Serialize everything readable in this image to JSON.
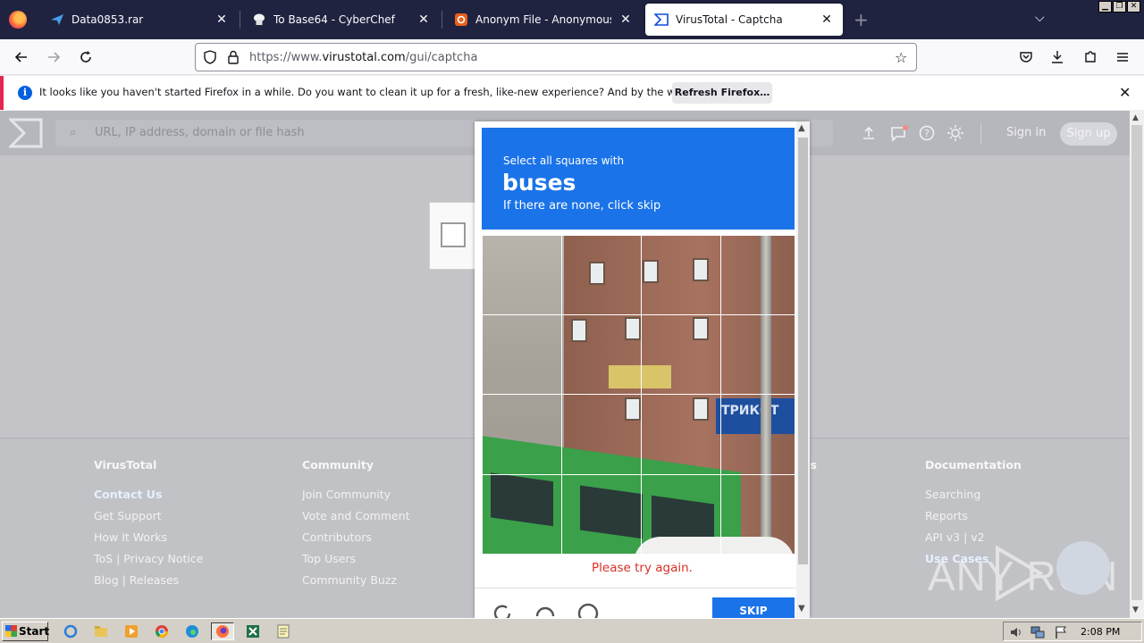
{
  "browser": {
    "tabs": [
      {
        "title": "Data0853.rar",
        "icon": "paperplane-icon"
      },
      {
        "title": "To Base64 - CyberChef",
        "icon": "chef-hat-icon"
      },
      {
        "title": "Anonym File - Anonymous File Uplo",
        "icon": "anonym-file-icon"
      },
      {
        "title": "VirusTotal - Captcha",
        "icon": "virustotal-icon",
        "active": true
      }
    ],
    "url_prefix": "https://www.",
    "url_domain": "virustotal.com",
    "url_path": "/gui/captcha"
  },
  "notification": {
    "message": "It looks like you haven't started Firefox in a while. Do you want to clean it up for a fresh, like-new experience? And by the way, welcome back!",
    "button": "Refresh Firefox…"
  },
  "vt": {
    "search_placeholder": "URL, IP address, domain or file hash",
    "signin": "Sign in",
    "signup": "Sign up"
  },
  "footer": {
    "columns": [
      {
        "heading": "VirusTotal",
        "links": [
          "Contact Us",
          "Get Support",
          "How It Works",
          "ToS | Privacy Notice",
          "Blog | Releases"
        ]
      },
      {
        "heading": "Community",
        "links": [
          "Join Community",
          "Vote and Comment",
          "Contributors",
          "Top Users",
          "Community Buzz"
        ]
      },
      {
        "heading": "es",
        "links": []
      },
      {
        "heading": "Documentation",
        "links": [
          "Searching",
          "Reports",
          "API v3 | v2",
          "Use Cases"
        ]
      }
    ]
  },
  "captcha": {
    "prompt": "Select all squares with",
    "target": "buses",
    "subtext": "If there are none, click skip",
    "error": "Please try again.",
    "skip_label": "SKIP",
    "sign_text": "ТРИКОТ"
  },
  "watermark": "ANY RUN",
  "taskbar": {
    "start": "Start",
    "time": "2:08 PM"
  },
  "colors": {
    "captcha_blue": "#1a73e8",
    "error_red": "#d93025",
    "firefox_tabbar": "#202340"
  }
}
